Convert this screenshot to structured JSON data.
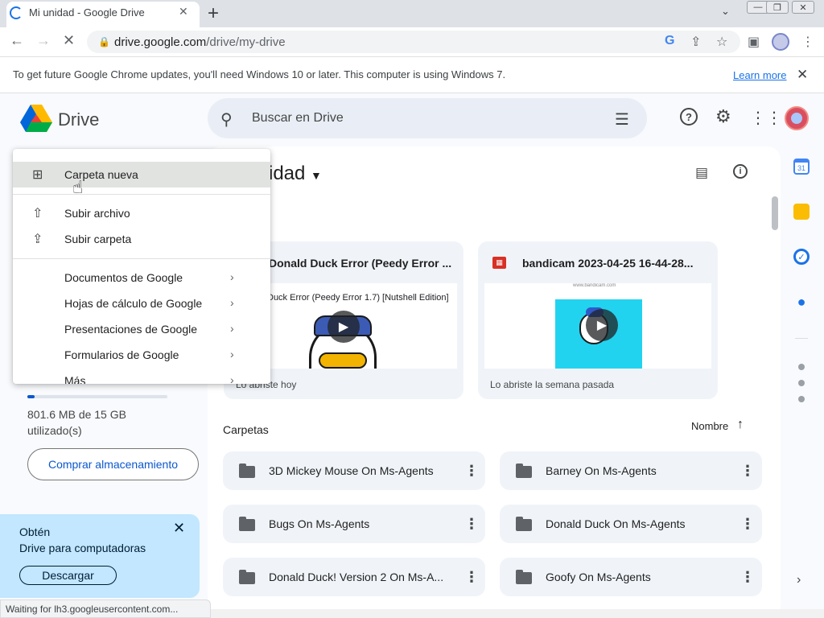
{
  "browser": {
    "tab_title": "Mi unidad - Google Drive",
    "new_tab_label": "+",
    "url_host": "drive.google.com",
    "url_path": "/drive/my-drive",
    "infobar_text": "To get future Google Chrome updates, you'll need Windows 10 or later. This computer is using Windows 7.",
    "infobar_link": "Learn more",
    "status_text": "Waiting for lh3.googleusercontent.com..."
  },
  "drive": {
    "app_name": "Drive",
    "search_placeholder": "Buscar en Drive",
    "page_title": "idad",
    "storage_text": "801.6 MB de 15 GB utilizado(s)",
    "storage_fraction": 0.05,
    "buy_storage_label": "Comprar almacenamiento",
    "promo": {
      "title": "Obtén",
      "subtitle": "Drive para computadoras",
      "button": "Descargar"
    }
  },
  "suggested": [
    {
      "title": "Donald Duck Error (Peedy Error ...",
      "thumb_caption": "Duck Error (Peedy Error 1.7) [Nutshell Edition]",
      "opened": "Lo abriste hoy"
    },
    {
      "title": "bandicam 2023-04-25 16-44-28...",
      "thumb_caption": "www.bandicam.com",
      "opened": "Lo abriste la semana pasada"
    }
  ],
  "folders_section": {
    "label": "Carpetas",
    "sort_label": "Nombre",
    "items": [
      "3D Mickey Mouse On Ms-Agents",
      "Barney On Ms-Agents",
      "Bugs On Ms-Agents",
      "Donald Duck On Ms-Agents",
      "Donald Duck! Version 2 On Ms-A...",
      "Goofy On Ms-Agents"
    ]
  },
  "new_menu": {
    "items": [
      {
        "label": "Carpeta nueva"
      },
      {
        "label": "Subir archivo"
      },
      {
        "label": "Subir carpeta"
      },
      {
        "label": "Documentos de Google"
      },
      {
        "label": "Hojas de cálculo de Google"
      },
      {
        "label": "Presentaciones de Google"
      },
      {
        "label": "Formularios de Google"
      },
      {
        "label": "Más"
      }
    ]
  },
  "colors": {
    "accent": "#0b57d0",
    "menu_highlight": "#e1e3e1",
    "promo_bg": "#c2e7ff"
  }
}
